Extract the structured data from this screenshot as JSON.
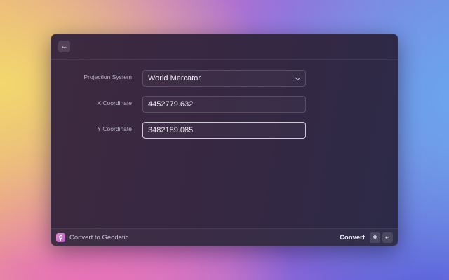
{
  "form": {
    "projection": {
      "label": "Projection System",
      "value": "World Mercator"
    },
    "x": {
      "label": "X Coordinate",
      "value": "4452779.632"
    },
    "y": {
      "label": "Y Coordinate",
      "value": "3482189.085"
    }
  },
  "footer": {
    "command_title": "Convert to Geodetic",
    "action_label": "Convert",
    "shortcut_keys": [
      "⌘",
      "↵"
    ]
  },
  "icons": {
    "back": "arrow-left-icon",
    "command": "map-pin-icon",
    "select": "chevron-down-icon"
  }
}
